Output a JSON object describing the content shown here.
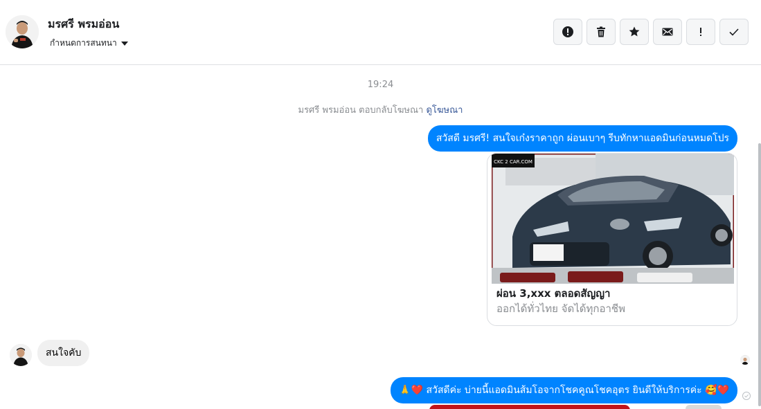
{
  "header": {
    "contact_name": "มรศรี พรมอ่อน",
    "conversation_action": "กำหนดการสนทนา",
    "toolbar": [
      {
        "name": "report-button",
        "icon": "alert-circle-icon"
      },
      {
        "name": "delete-button",
        "icon": "trash-icon"
      },
      {
        "name": "star-button",
        "icon": "star-icon"
      },
      {
        "name": "mark-unread-button",
        "icon": "envelope-icon"
      },
      {
        "name": "important-button",
        "icon": "exclamation-icon"
      },
      {
        "name": "done-button",
        "icon": "checkmark-icon"
      }
    ]
  },
  "chat": {
    "timestamp": "19:24",
    "reply_note_prefix": "มรศรี พรมอ่อน ตอบกลับโฆษณา",
    "reply_note_link": "ดูโฆษณา",
    "messages": [
      {
        "direction": "out",
        "text": "สวัสดี มรศรี! สนใจเก๋งราคาถูก ผ่อนเบาๆ รีบทักหาแอดมินก่อนหมดโปร"
      },
      {
        "direction": "in",
        "text": "สนใจคับ"
      },
      {
        "direction": "out",
        "text": "🙏❤️ สวัสดีค่ะ บ่ายนี้แอดมินส้มโอจากโชคคูณโชคอุตร ยินดีให้บริการค่ะ 🥰❤️"
      }
    ],
    "ad_card": {
      "watermark": "CKC 2 CAR.COM",
      "title": "ผ่อน 3,xxx ตลอดสัญญา",
      "subtitle": "ออกได้ทั่วไทย จัดได้ทุกอาชีพ"
    }
  },
  "colors": {
    "outgoing_bubble": "#0084ff",
    "incoming_bubble": "#f0f0f0",
    "link": "#385898"
  }
}
